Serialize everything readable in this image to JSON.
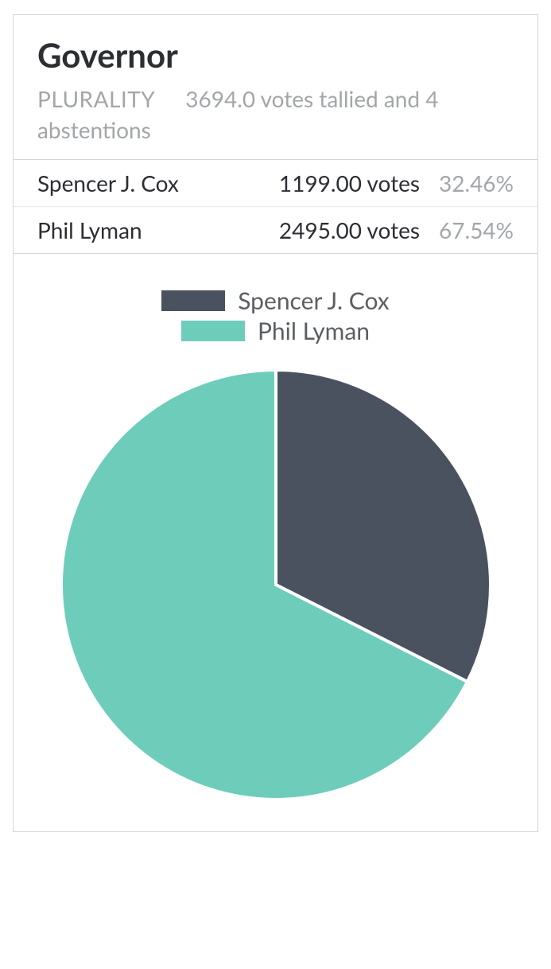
{
  "header": {
    "title": "Governor",
    "tag": "PLURALITY",
    "tally_text": "3694.0 votes tallied and 4 abstentions"
  },
  "candidates": [
    {
      "name": "Spencer J. Cox",
      "votes_text": "1199.00 votes",
      "pct_text": "32.46%"
    },
    {
      "name": "Phil Lyman",
      "votes_text": "2495.00 votes",
      "pct_text": "67.54%"
    }
  ],
  "legend": [
    {
      "label": "Spencer J. Cox",
      "color": "#4a5260"
    },
    {
      "label": "Phil Lyman",
      "color": "#6ecdba"
    }
  ],
  "chart_data": {
    "type": "pie",
    "title": "Governor",
    "series": [
      {
        "name": "Spencer J. Cox",
        "value": 1199.0,
        "pct": 32.46,
        "color": "#4a5260"
      },
      {
        "name": "Phil Lyman",
        "value": 2495.0,
        "pct": 67.54,
        "color": "#6ecdba"
      }
    ]
  }
}
